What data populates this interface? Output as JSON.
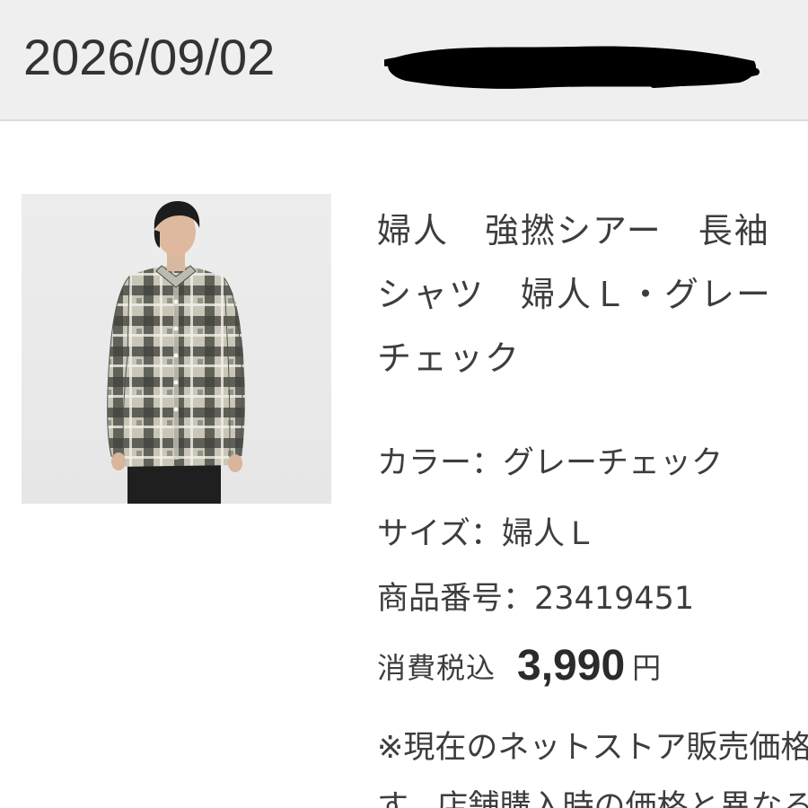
{
  "header": {
    "order_date": "2026/09/02"
  },
  "product": {
    "image_icon": "product-photo-plaid-shirt",
    "title": "婦人　強撚シアー　長袖シャツ　婦人Ｌ・グレーチェック",
    "color_label": "カラー：",
    "color_value": "グレーチェック",
    "size_label": "サイズ：",
    "size_value": "婦人Ｌ",
    "code_label": "商品番号：",
    "code_value": "23419451",
    "price_label": "消費税込",
    "price_value": "3,990",
    "price_unit": "円"
  },
  "notice": {
    "text": "※現在のネットストア販売価格です。店舗購入時の価格と異なる"
  },
  "colors": {
    "header_bg": "#efefef",
    "text": "#3d3d3d",
    "redaction": "#000000"
  }
}
